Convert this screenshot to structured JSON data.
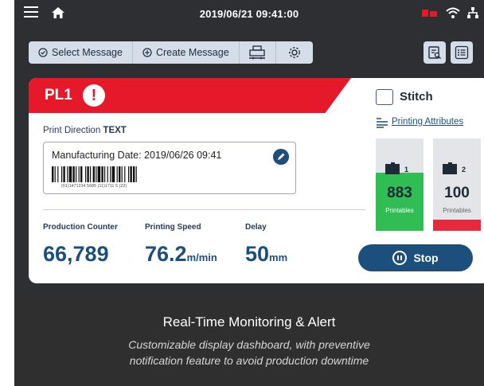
{
  "status_bar": {
    "datetime": "2019/06/21 09:41:00"
  },
  "toolbar": {
    "select_message": "Select Message",
    "create_message": "Create Message"
  },
  "line_panel": {
    "line_name": "PL1",
    "alert_symbol": "!",
    "print_direction_label": "Print Direction",
    "print_direction_value": "TEXT",
    "message_text": "Manufacturing Date: 2019/06/26 09:41",
    "barcode_number": "(01)1471234 5685 (11)1711 5 (22)"
  },
  "metrics": {
    "production_counter_label": "Production Counter",
    "production_counter_value": "66,789",
    "printing_speed_label": "Printing Speed",
    "printing_speed_value": "76.2",
    "printing_speed_unit": "m/min",
    "delay_label": "Delay",
    "delay_value": "50",
    "delay_unit": "mm"
  },
  "right_panel": {
    "stitch_label": "Stitch",
    "printing_attributes_link": "Printing Attributes",
    "cartridges": [
      {
        "index": "1",
        "count": "883",
        "sub_label": "Printables",
        "fill_color": "#2fbd54",
        "fill_level": 0.63
      },
      {
        "index": "2",
        "count": "100",
        "sub_label": "Printables",
        "fill_color": "#e8293b",
        "fill_level": 0.12
      }
    ],
    "stop_button": "Stop"
  },
  "caption": {
    "title": "Real-Time Monitoring & Alert",
    "subtitle_line1": "Customizable display dashboard, with preventive",
    "subtitle_line2": "notification feature to avoid production downtime"
  },
  "colors": {
    "alert_red": "#e5192a",
    "primary_blue": "#1d4f7c",
    "screen_bg": "#2d2f33"
  }
}
